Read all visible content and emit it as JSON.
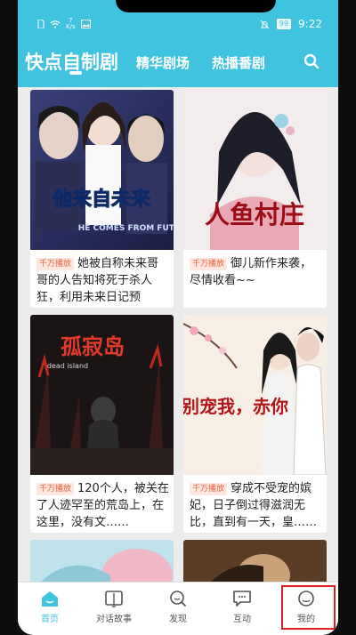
{
  "status_bar": {
    "network_speed": "7",
    "network_unit": "K/s",
    "battery": "99",
    "time": "9:22"
  },
  "top_bar": {
    "tabs": [
      "快点自制剧",
      "精华剧场",
      "热播番剧"
    ],
    "active_tab": 0,
    "accent_color": "#3fc3de"
  },
  "cards": [
    {
      "cover_title": "他来自未来",
      "cover_subtitle": "HE COMES FROM FUTURE",
      "badge": "千万播放",
      "description": "她被自称未来哥哥的人告知将死于杀人狂，利用未来日记预知……"
    },
    {
      "cover_title": "人鱼村庄",
      "badge": "千万播放",
      "description": "御儿新作来袭，尽情收看~~"
    },
    {
      "cover_title": "孤寂岛",
      "cover_subtitle": "dead island",
      "badge": "千万播放",
      "description": "120个人，被关在了人迹罕至的荒岛上，在这里，没有文……"
    },
    {
      "cover_title": "皇上别宠我，赤你",
      "badge": "千万播放",
      "description": "穿成不受宠的嫔妃，日子倒过得滋润无比，直到有一天，皇……"
    }
  ],
  "bottom_nav": {
    "items": [
      "首页",
      "对话故事",
      "发现",
      "互动",
      "我的"
    ],
    "active_index": 0,
    "active_color": "#3fc3de",
    "highlight_index": 4
  }
}
